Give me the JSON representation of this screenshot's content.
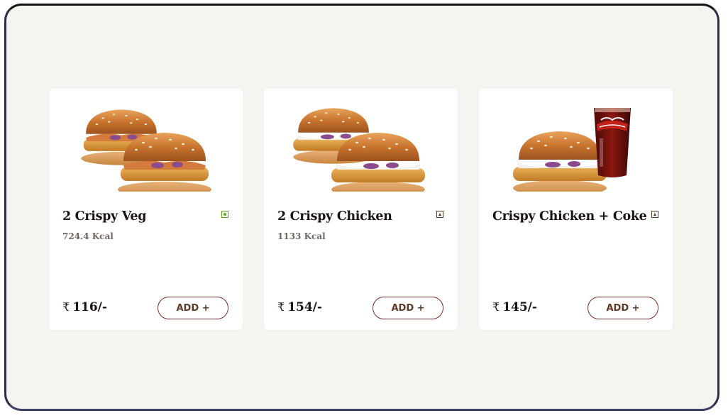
{
  "colors": {
    "page_bg": "#f6f4f0",
    "card_bg": "#ffffff",
    "text": "#1c1412",
    "muted": "#6f6762",
    "button_border": "#7a2e24",
    "button_text": "#5b3a28",
    "veg": "#59a91a",
    "nonveg": "#5b3a28"
  },
  "products": [
    {
      "name": "2 Crispy Veg",
      "kcal": "724.4 Kcal",
      "price": "116/-",
      "currency": "₹",
      "diet": "veg",
      "image": "two-crispy-veg-burgers",
      "add_label": "ADD +"
    },
    {
      "name": "2 Crispy Chicken",
      "kcal": "1133 Kcal",
      "price": "154/-",
      "currency": "₹",
      "diet": "non-veg",
      "image": "two-crispy-chicken-burgers",
      "add_label": "ADD +"
    },
    {
      "name": "Crispy Chicken + Coke",
      "kcal": "",
      "price": "145/-",
      "currency": "₹",
      "diet": "non-veg",
      "image": "crispy-chicken-burger-with-coke",
      "add_label": "ADD +"
    }
  ]
}
